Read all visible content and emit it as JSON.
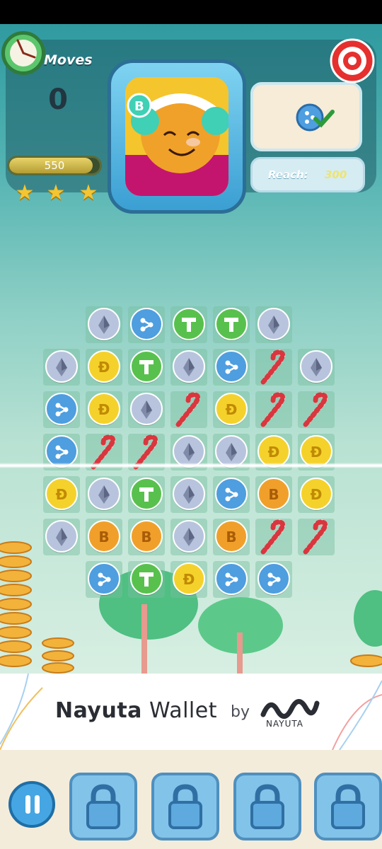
{
  "hud": {
    "moves_label": "Moves",
    "moves_value": "0",
    "score_value": "550",
    "score_progress": 0.92,
    "stars_count": 3,
    "reach_label": "Reach:",
    "reach_value": "300",
    "goal_icon": "ripple-coin-check-icon",
    "target_icon": "target-icon",
    "timer_icon": "clock-icon"
  },
  "board": {
    "rows": [
      [
        "",
        "eth",
        "xrp",
        "usdt",
        "usdt",
        "eth",
        ""
      ],
      [
        "eth",
        "doge",
        "usdt",
        "eth",
        "xrp",
        "cane",
        "eth"
      ],
      [
        "xrp",
        "doge",
        "eth",
        "cane",
        "doge",
        "cane",
        "cane"
      ],
      [
        "xrp",
        "cane",
        "cane",
        "eth",
        "eth",
        "doge",
        "doge"
      ],
      [
        "doge",
        "eth",
        "usdt",
        "eth",
        "xrp",
        "btc",
        "doge"
      ],
      [
        "eth",
        "btc",
        "btc",
        "eth",
        "btc",
        "cane",
        "cane"
      ],
      [
        "",
        "xrp",
        "usdt",
        "doge",
        "xrp",
        "xrp",
        ""
      ]
    ]
  },
  "footer": {
    "brand_bold": "Nayuta",
    "brand_rest": " Wallet",
    "by": "by",
    "logo_text": "NAYUTA"
  },
  "boosters": [
    {
      "icon": "lock-icon"
    },
    {
      "icon": "lock-icon"
    },
    {
      "icon": "lock-icon"
    },
    {
      "icon": "lock-icon"
    }
  ],
  "colors": {
    "eth": "#b8c4dd",
    "xrp": "#4e9ee0",
    "usdt": "#58c14d",
    "doge": "#f5d22b",
    "btc": "#f0a02a"
  }
}
